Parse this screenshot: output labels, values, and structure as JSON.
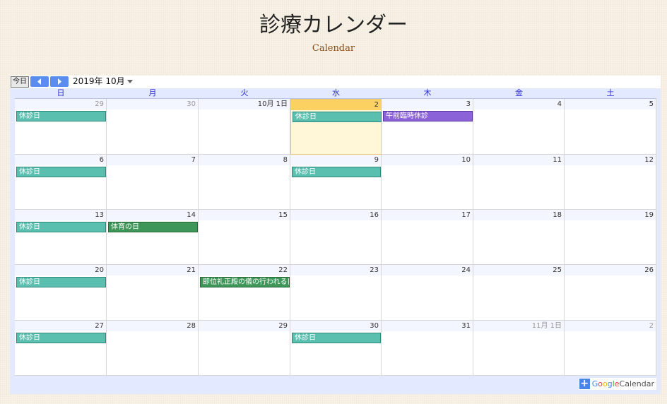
{
  "page": {
    "title": "診療カレンダー",
    "subtitle": "Calendar"
  },
  "toolbar": {
    "today_label": "今日",
    "prev_icon": "chevron-left-icon",
    "next_icon": "chevron-right-icon",
    "month_label": "2019年 10月",
    "dropdown_icon": "caret-down-icon"
  },
  "weekdays": [
    "日",
    "月",
    "火",
    "水",
    "木",
    "金",
    "土"
  ],
  "weeks": [
    [
      {
        "label": "29",
        "other": true,
        "events": [
          {
            "title": "休診日",
            "color": "teal"
          }
        ]
      },
      {
        "label": "30",
        "other": true,
        "events": []
      },
      {
        "label": "10月 1日",
        "events": []
      },
      {
        "label": "2",
        "today": true,
        "events": [
          {
            "title": "休診日",
            "color": "teal"
          }
        ]
      },
      {
        "label": "3",
        "events": [
          {
            "title": "午前臨時休診",
            "color": "purple"
          }
        ]
      },
      {
        "label": "4",
        "events": []
      },
      {
        "label": "5",
        "events": []
      }
    ],
    [
      {
        "label": "6",
        "events": [
          {
            "title": "休診日",
            "color": "teal"
          }
        ]
      },
      {
        "label": "7",
        "events": []
      },
      {
        "label": "8",
        "events": []
      },
      {
        "label": "9",
        "events": [
          {
            "title": "休診日",
            "color": "teal"
          }
        ]
      },
      {
        "label": "10",
        "events": []
      },
      {
        "label": "11",
        "events": []
      },
      {
        "label": "12",
        "events": []
      }
    ],
    [
      {
        "label": "13",
        "events": [
          {
            "title": "休診日",
            "color": "teal"
          }
        ]
      },
      {
        "label": "14",
        "events": [
          {
            "title": "体育の日",
            "color": "green"
          }
        ]
      },
      {
        "label": "15",
        "events": []
      },
      {
        "label": "16",
        "events": []
      },
      {
        "label": "17",
        "events": []
      },
      {
        "label": "18",
        "events": []
      },
      {
        "label": "19",
        "events": []
      }
    ],
    [
      {
        "label": "20",
        "events": [
          {
            "title": "休診日",
            "color": "teal"
          }
        ]
      },
      {
        "label": "21",
        "events": []
      },
      {
        "label": "22",
        "events": [
          {
            "title": "即位礼正殿の儀の行われる日",
            "color": "green"
          }
        ]
      },
      {
        "label": "23",
        "events": []
      },
      {
        "label": "24",
        "events": []
      },
      {
        "label": "25",
        "events": []
      },
      {
        "label": "26",
        "events": []
      }
    ],
    [
      {
        "label": "27",
        "events": [
          {
            "title": "休診日",
            "color": "teal"
          }
        ]
      },
      {
        "label": "28",
        "events": []
      },
      {
        "label": "29",
        "events": []
      },
      {
        "label": "30",
        "events": [
          {
            "title": "休診日",
            "color": "teal"
          }
        ]
      },
      {
        "label": "31",
        "events": []
      },
      {
        "label": "11月 1日",
        "other": true,
        "events": []
      },
      {
        "label": "2",
        "other": true,
        "events": []
      }
    ]
  ],
  "colors": {
    "teal": "#5bbfb0",
    "purple": "#8b62d8",
    "green": "#3f9659",
    "today": "#fbd262",
    "weekday_text": "#2a2ad0"
  },
  "footer": {
    "plus_icon": "plus-icon",
    "google_word": [
      "G",
      "o",
      "o",
      "g",
      "l",
      "e"
    ],
    "calendar_word": "Calendar"
  }
}
